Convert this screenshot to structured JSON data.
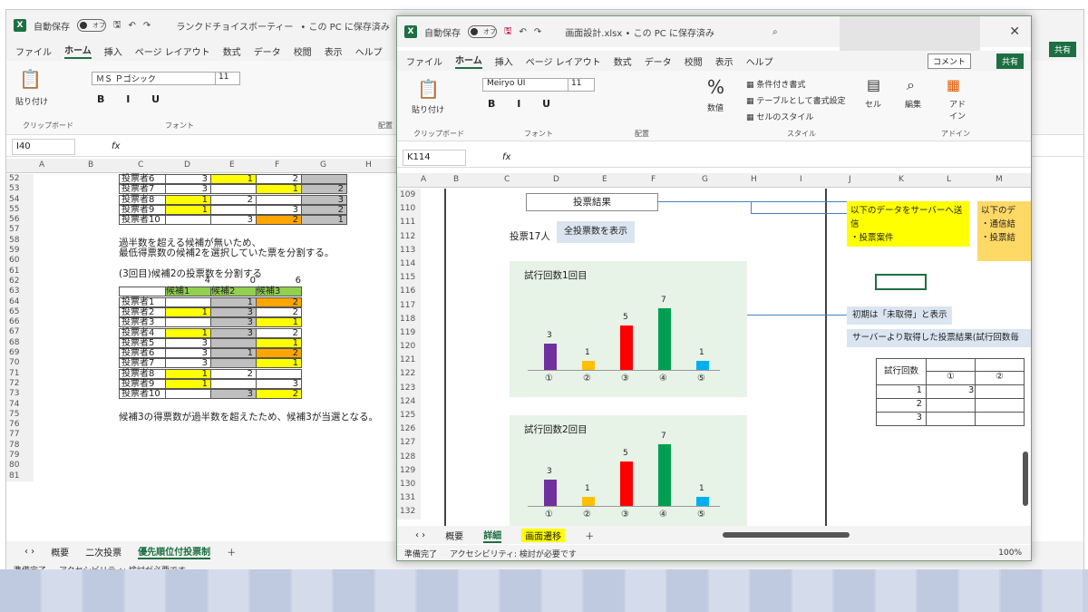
{
  "bg": {
    "title": "ランクドチョイスボーティー",
    "autosave": "自動保存",
    "toggle": "オフ",
    "saved": "• この PC に保存済み",
    "share": "共有",
    "menu": [
      "ファイル",
      "ホーム",
      "挿入",
      "ページ レイアウト",
      "数式",
      "データ",
      "校閲",
      "表示",
      "ヘルプ"
    ],
    "font_name": "ＭＳ Ｐゴシック",
    "font_size": "11",
    "paste": "貼り付け",
    "clipboard": "クリップボード",
    "font_group": "フォント",
    "align_group": "配置",
    "namebox": "I40",
    "cols": [
      "A",
      "B",
      "C",
      "D",
      "E",
      "F",
      "G",
      "H"
    ],
    "rows": [
      "52",
      "53",
      "54",
      "55",
      "56",
      "57",
      "58",
      "59",
      "60",
      "61",
      "62",
      "63",
      "64",
      "65",
      "66",
      "67",
      "68",
      "69",
      "70",
      "71",
      "72",
      "73",
      "74",
      "75",
      "76",
      "77",
      "78",
      "79",
      "80",
      "81"
    ],
    "table1": [
      [
        "投票者6",
        "3",
        "1",
        "2",
        ""
      ],
      [
        "投票者7",
        "3",
        "",
        "1",
        "2"
      ],
      [
        "投票者8",
        "1",
        "2",
        "",
        "3"
      ],
      [
        "投票者9",
        "1",
        "",
        "3",
        "2"
      ],
      [
        "投票者10",
        "",
        "3",
        "2",
        "1"
      ]
    ],
    "note1": "過半数を超える候補が無いため、",
    "note2": "最低得票数の候補2を選択していた票を分割する。",
    "note3": "(3回目)候補2の投票数を分割する",
    "counts": [
      "4",
      "0",
      "6"
    ],
    "headers": [
      "候補1",
      "候補2",
      "候補3"
    ],
    "table2": [
      [
        "投票者1",
        "",
        "1",
        "2"
      ],
      [
        "投票者2",
        "1",
        "3",
        "2"
      ],
      [
        "投票者3",
        "",
        "3",
        "1"
      ],
      [
        "投票者4",
        "1",
        "3",
        "2"
      ],
      [
        "投票者5",
        "3",
        "",
        "1"
      ],
      [
        "投票者6",
        "3",
        "1",
        "2"
      ],
      [
        "投票者7",
        "3",
        "",
        "1"
      ],
      [
        "投票者8",
        "1",
        "2",
        ""
      ],
      [
        "投票者9",
        "1",
        "",
        "3"
      ],
      [
        "投票者10",
        "",
        "3",
        "2"
      ]
    ],
    "note4": "候補3の得票数が過半数を超えたため、候補3が当選となる。",
    "tabs": [
      "概要",
      "二次投票",
      "優先順位付投票制"
    ],
    "status": "準備完了",
    "access": "アクセシビリティ: 検討が必要です"
  },
  "fg": {
    "title": "画面設計.xlsx • この PC に保存済み",
    "autosave": "自動保存",
    "toggle": "オフ",
    "menu": [
      "ファイル",
      "ホーム",
      "挿入",
      "ページ レイアウト",
      "数式",
      "データ",
      "校閲",
      "表示",
      "ヘルプ"
    ],
    "comment": "コメント",
    "share": "共有",
    "font_name": "Meiryo UI",
    "font_size": "11",
    "paste": "貼り付け",
    "clipboard": "クリップボード",
    "font_group": "フォント",
    "align_group": "配置",
    "percent": "%",
    "number": "数値",
    "cond": "条件付き書式",
    "table_fmt": "テーブルとして書式設定",
    "cell_style": "セルのスタイル",
    "style_group": "スタイル",
    "cell": "セル",
    "edit": "編集",
    "addin": "アド イン",
    "addin_group": "アドイン",
    "namebox": "K114",
    "cols": [
      "A",
      "B",
      "C",
      "D",
      "E",
      "F",
      "G",
      "H",
      "I",
      "J",
      "K",
      "L",
      "M"
    ],
    "rows": [
      "109",
      "110",
      "111",
      "112",
      "113",
      "114",
      "115",
      "116",
      "117",
      "118",
      "119",
      "120",
      "121",
      "122",
      "123",
      "124",
      "125",
      "126",
      "127",
      "128",
      "129",
      "130",
      "131",
      "132"
    ],
    "result_btn": "投票結果",
    "voters": "投票17人",
    "show_all": "全投票数を表示",
    "send_title": "以下のデータをサーバーへ送信",
    "send_item": "・投票案件",
    "right_title": "以下のデ",
    "right_item1": "・通信結",
    "right_item2": "・投票結",
    "init_note": "初期は「未取得」と表示",
    "server_note": "サーバーより取得した投票結果(試行回数毎",
    "trial_hdr": "試行回数",
    "trial_cols": [
      "①",
      "②"
    ],
    "trial_rows": [
      [
        "1",
        "3"
      ],
      [
        "2",
        ""
      ],
      [
        "3",
        ""
      ]
    ],
    "tabs": [
      "概要",
      "詳細",
      "画面遷移"
    ],
    "status": "準備完了",
    "access": "アクセシビリティ: 検討が必要です",
    "zoom": "100%"
  },
  "chart_data": [
    {
      "type": "bar",
      "title": "試行回数1回目",
      "categories": [
        "①",
        "②",
        "③",
        "④",
        "⑤"
      ],
      "values": [
        3,
        1,
        5,
        7,
        1
      ],
      "colors": [
        "#7030a0",
        "#ffc000",
        "#ff0000",
        "#00a050",
        "#00b0f0"
      ]
    },
    {
      "type": "bar",
      "title": "試行回数2回目",
      "categories": [
        "①",
        "②",
        "③",
        "④",
        "⑤"
      ],
      "values": [
        3,
        1,
        5,
        7,
        1
      ],
      "colors": [
        "#7030a0",
        "#ffc000",
        "#ff0000",
        "#00a050",
        "#00b0f0"
      ]
    }
  ]
}
